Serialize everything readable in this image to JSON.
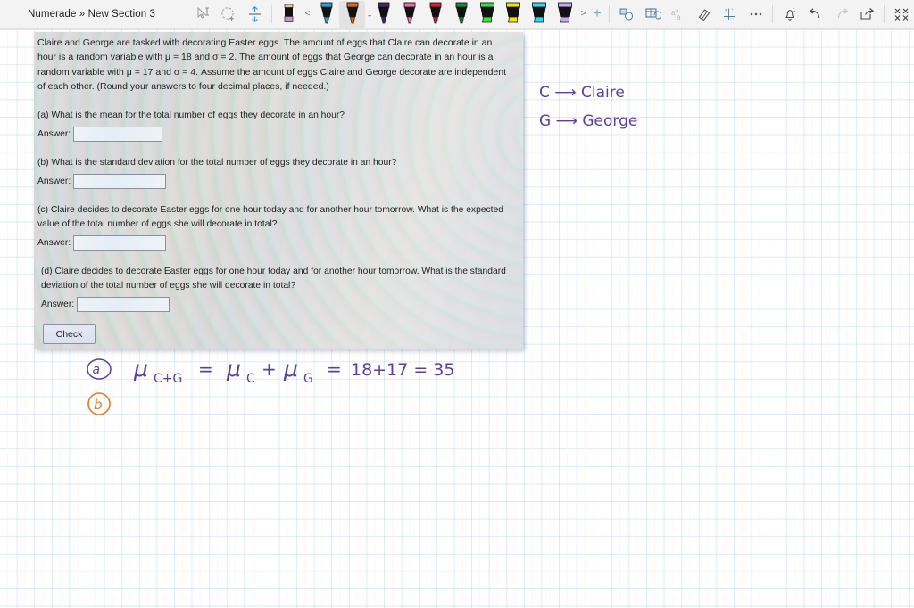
{
  "window": {
    "title": "Numerade » New Section 3"
  },
  "toolbar": {
    "tools": [
      {
        "name": "select-text-icon",
        "label": "Select"
      },
      {
        "name": "lasso-select-icon",
        "label": "Lasso Select"
      },
      {
        "name": "insert-space-icon",
        "label": "Insert Space"
      },
      {
        "name": "eraser-tool-icon",
        "label": "Eraser"
      }
    ],
    "pen_prev_label": "<",
    "pens": [
      {
        "name": "pen-cyan",
        "color": "#1fa5d8",
        "type": "pen"
      },
      {
        "name": "pen-orange",
        "color": "#ec6608",
        "type": "pen",
        "selected": true
      },
      {
        "name": "pen-purple",
        "color": "#4a1f7a",
        "type": "pen"
      },
      {
        "name": "pen-pink",
        "color": "#f06ba8",
        "type": "pen"
      },
      {
        "name": "pen-red",
        "color": "#e01b24",
        "type": "pen"
      },
      {
        "name": "pen-green",
        "color": "#0a8f3c",
        "type": "pen"
      },
      {
        "name": "highlighter-green",
        "color": "#38e23c",
        "type": "highlighter"
      },
      {
        "name": "highlighter-yellow",
        "color": "#f6e400",
        "type": "highlighter"
      },
      {
        "name": "highlighter-cyan",
        "color": "#2fd8f2",
        "type": "highlighter"
      },
      {
        "name": "highlighter-lavender",
        "color": "#cda6f0",
        "type": "highlighter"
      }
    ],
    "pen_next_label": ">",
    "add_pen_label": "+",
    "right_tools": [
      {
        "name": "ink-to-shape-icon",
        "label": "Ink to Shape"
      },
      {
        "name": "ink-to-table-icon",
        "label": "Ink to Table"
      },
      {
        "name": "ink-to-text-icon",
        "label": "Ink to Text"
      },
      {
        "name": "eraser-icon",
        "label": "Eraser"
      },
      {
        "name": "ink-to-math-icon",
        "label": "Ink to Math"
      },
      {
        "name": "more-options-icon",
        "label": "More"
      },
      {
        "name": "notification-bell-icon",
        "label": "Notifications",
        "badge": "1"
      },
      {
        "name": "undo-icon",
        "label": "Undo"
      },
      {
        "name": "redo-icon",
        "label": "Redo"
      },
      {
        "name": "share-icon",
        "label": "Share"
      },
      {
        "name": "collapse-ribbon-icon",
        "label": "Collapse"
      }
    ]
  },
  "screenshot": {
    "problem": "Claire and George are tasked with decorating Easter eggs. The amount of eggs that Claire can decorate in an hour is a random variable with μ = 18 and σ = 2. The amount of eggs that George can decorate in an hour is a random variable with μ = 17 and σ = 4. Assume the amount of eggs Claire and George decorate are independent of each other. (Round your answers to four decimal places, if needed.)",
    "parts": [
      {
        "id": "a",
        "question": "(a) What is the mean for the total number of eggs they decorate in an hour?",
        "answer_label": "Answer:",
        "answer_value": ""
      },
      {
        "id": "b",
        "question": "(b) What is the standard deviation for the total number of eggs they decorate in an hour?",
        "answer_label": "Answer:",
        "answer_value": ""
      },
      {
        "id": "c",
        "question": "(c) Claire decides to decorate Easter eggs for one hour today and for another hour tomorrow. What is the expected value of the total number of eggs she will decorate in total?",
        "answer_label": "Answer:",
        "answer_value": ""
      },
      {
        "id": "d",
        "question": "(d) Claire decides to decorate Easter eggs for one hour today and for another hour tomorrow. What is the standard deviation of the total number of eggs she will decorate in total?",
        "answer_label": "Answer:",
        "answer_value": ""
      }
    ],
    "check_button_label": "Check"
  },
  "handwriting": {
    "legend": [
      {
        "name": "legend-claire",
        "text": "C ⟶ Claire",
        "color": "#5b3fa0"
      },
      {
        "name": "legend-george",
        "text": "G ⟶ George",
        "color": "#5b3fa0"
      }
    ],
    "work": {
      "part_a_marker": "(a)",
      "part_a_line": "μ",
      "part_a_sub1": "C+G",
      "part_a_eq1": "=",
      "part_a_mu2": "μ",
      "part_a_sub2": "C",
      "part_a_plus": "+",
      "part_a_mu3": "μ",
      "part_a_sub3": "G",
      "part_a_eq2": "=",
      "part_a_calc": "18+17 = 35",
      "part_b_marker": "(b)",
      "ink_color": "#5b3fa0",
      "marker_color": "#e07a2a"
    }
  }
}
